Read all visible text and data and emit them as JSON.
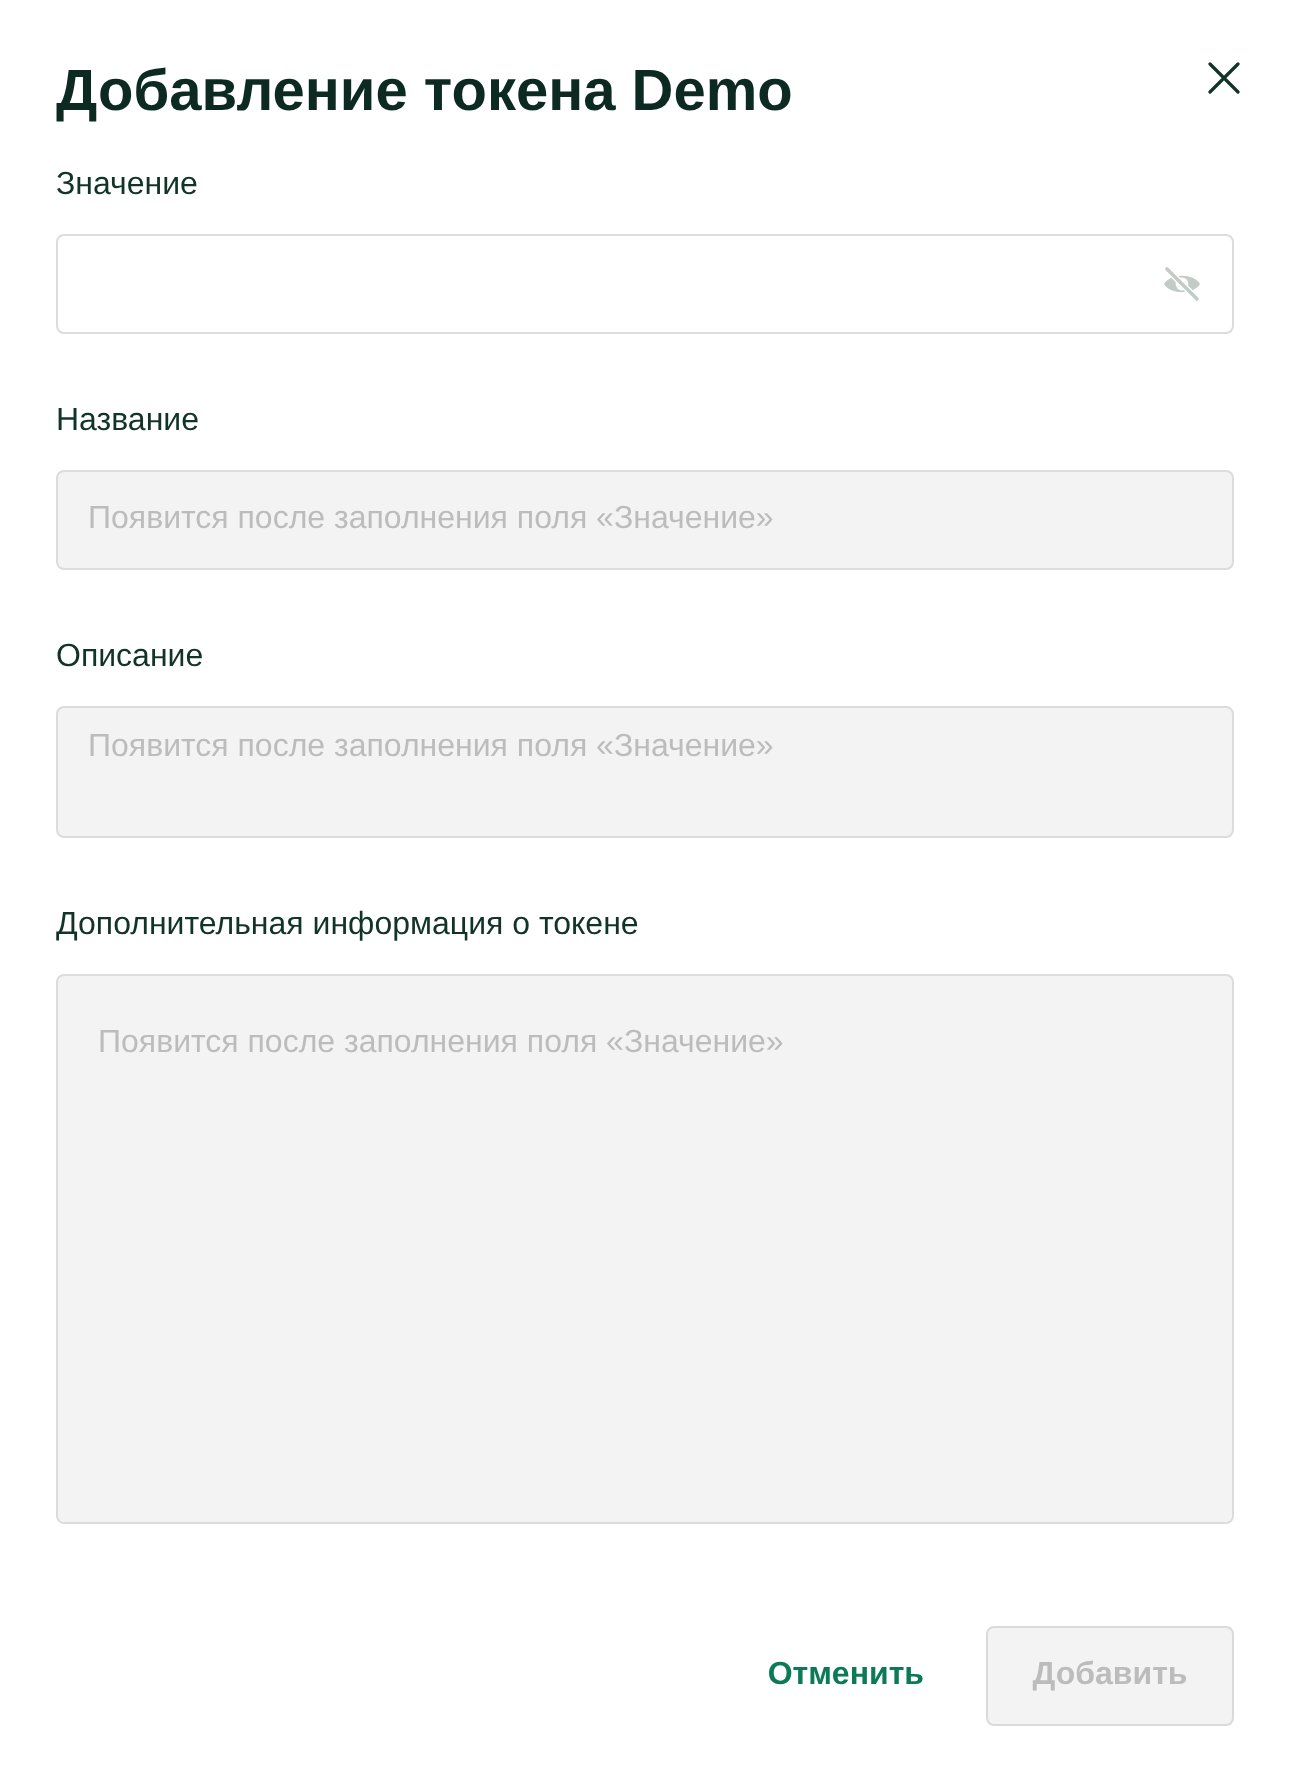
{
  "dialog": {
    "title": "Добавление токена Demo"
  },
  "fields": [
    {
      "label": "Значение",
      "kind": "input",
      "disabled": false,
      "value_hidden": true
    },
    {
      "label": "Название",
      "kind": "input",
      "placeholder": "Появится после заполнения поля «Значение»",
      "disabled": true
    },
    {
      "label": "Описание",
      "kind": "textarea",
      "placeholder": "Появится после заполнения поля «Значение»",
      "disabled": true
    },
    {
      "label": "Дополнительная информация о токене",
      "kind": "panel",
      "placeholder": "Появится после заполнения поля «Значение»",
      "disabled": true
    }
  ],
  "actions": [
    {
      "label": "Отменить",
      "kind": "text",
      "disabled": false
    },
    {
      "label": "Добавить",
      "kind": "filled",
      "disabled": true
    }
  ]
}
